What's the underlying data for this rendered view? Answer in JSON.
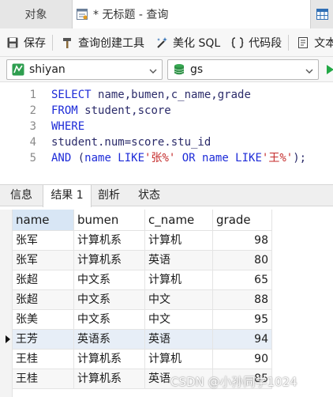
{
  "tabs": {
    "objects_label": "对象",
    "query_label": "* 无标题 - 查询"
  },
  "toolbar": {
    "save_label": "保存",
    "query_builder_label": "查询创建工具",
    "beautify_label": "美化 SQL",
    "snippet_label": "代码段",
    "text_label": "文本"
  },
  "connection": {
    "connection_name": "shiyan",
    "database_name": "gs"
  },
  "editor": {
    "lines": [
      {
        "num": "1",
        "parts": [
          [
            "kw",
            "SELECT "
          ],
          [
            "pl",
            "name,bumen,c_name,grade"
          ]
        ]
      },
      {
        "num": "2",
        "parts": [
          [
            "kw",
            "FROM "
          ],
          [
            "pl",
            "student,score"
          ]
        ]
      },
      {
        "num": "3",
        "parts": [
          [
            "kw",
            "WHERE"
          ]
        ]
      },
      {
        "num": "4",
        "parts": [
          [
            "pl",
            "student.num=score.stu_id"
          ]
        ]
      },
      {
        "num": "5",
        "parts": [
          [
            "kw",
            "AND "
          ],
          [
            "pl",
            "("
          ],
          [
            "kw",
            "name LIKE"
          ],
          [
            "str",
            "'张%'"
          ],
          [
            "kw",
            " OR name LIKE"
          ],
          [
            "str",
            "'王%'"
          ],
          [
            "pl",
            ");"
          ]
        ]
      }
    ]
  },
  "result_tabs": {
    "info_label": "信息",
    "result_label": "结果 1",
    "profile_label": "剖析",
    "status_label": "状态"
  },
  "grid": {
    "columns": [
      "name",
      "bumen",
      "c_name",
      "grade"
    ],
    "rows": [
      [
        "张军",
        "计算机系",
        "计算机",
        "98"
      ],
      [
        "张军",
        "计算机系",
        "英语",
        "80"
      ],
      [
        "张超",
        "中文系",
        "计算机",
        "65"
      ],
      [
        "张超",
        "中文系",
        "中文",
        "88"
      ],
      [
        "张美",
        "中文系",
        "中文",
        "95"
      ],
      [
        "王芳",
        "英语系",
        "英语",
        "94"
      ],
      [
        "王桂",
        "计算机系",
        "计算机",
        "90"
      ],
      [
        "王桂",
        "计算机系",
        "英语",
        "85"
      ]
    ],
    "selected_row": 5
  },
  "watermark": "CSDN @小孙同学1024",
  "colors": {
    "keyword": "#1d2bd8",
    "string": "#c42a2a",
    "run": "#22a845"
  }
}
